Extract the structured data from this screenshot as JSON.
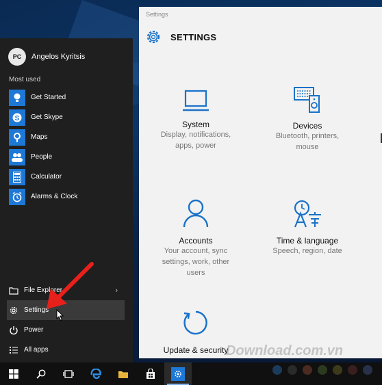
{
  "settings_window": {
    "title": "Settings",
    "header": "SETTINGS",
    "categories": [
      {
        "name": "System",
        "desc1": "Display, notifications,",
        "desc2": "apps, power",
        "desc3": ""
      },
      {
        "name": "Devices",
        "desc1": "Bluetooth, printers,",
        "desc2": "mouse",
        "desc3": ""
      },
      {
        "name": "Accounts",
        "desc1": "Your account, sync",
        "desc2": "settings, work, other",
        "desc3": "users"
      },
      {
        "name": "Time & language",
        "desc1": "Speech, region, date",
        "desc2": "",
        "desc3": ""
      },
      {
        "name": "Update & security",
        "desc1": "",
        "desc2": "",
        "desc3": ""
      }
    ]
  },
  "start_menu": {
    "user_name": "Angelos Kyritsis",
    "avatar_text": "PC",
    "most_used_label": "Most used",
    "apps": [
      {
        "label": "Get Started",
        "icon": "lightbulb-icon"
      },
      {
        "label": "Get Skype",
        "icon": "skype-icon"
      },
      {
        "label": "Maps",
        "icon": "maps-icon"
      },
      {
        "label": "People",
        "icon": "people-icon"
      },
      {
        "label": "Calculator",
        "icon": "calculator-icon"
      },
      {
        "label": "Alarms & Clock",
        "icon": "alarm-icon"
      }
    ],
    "bottom": [
      {
        "label": "File Explorer",
        "icon": "folder-icon"
      },
      {
        "label": "Settings",
        "icon": "gear-icon"
      },
      {
        "label": "Power",
        "icon": "power-icon"
      },
      {
        "label": "All apps",
        "icon": "all-apps-icon"
      }
    ]
  },
  "taskbar": {
    "items": [
      "start-button",
      "search",
      "task-view",
      "edge",
      "file-explorer",
      "store",
      "settings"
    ]
  },
  "watermark": "Download.com.vn",
  "colors": {
    "accent": "#1e78d6",
    "settings_icon": "#1a72c9",
    "start_bg": "#1f1f1f",
    "taskbar_bg": "#101010",
    "arrow": "#e8201c"
  }
}
